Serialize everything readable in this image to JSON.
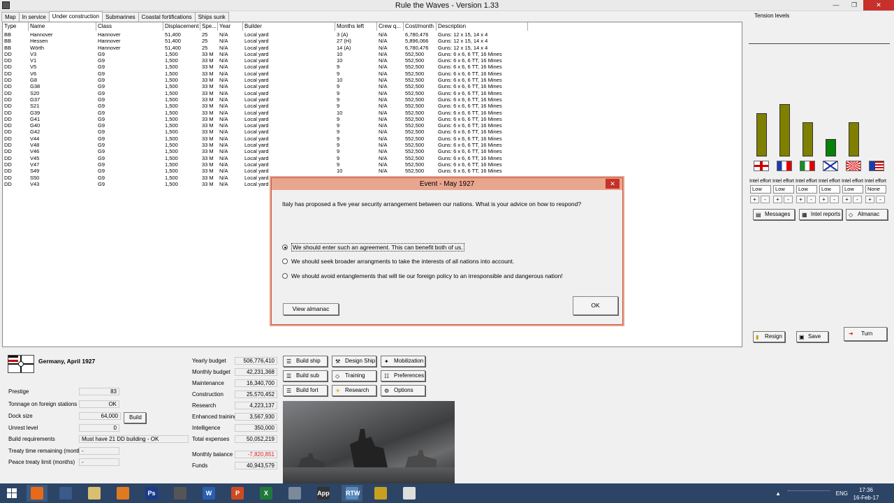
{
  "window": {
    "title": "Rule the Waves - Version 1.33",
    "minimize": "—",
    "restore": "❐",
    "close": "✕"
  },
  "tabs": [
    "Map",
    "In service",
    "Under construction",
    "Submarines",
    "Coastal fortifications",
    "Ships sunk"
  ],
  "active_tab": "Under construction",
  "table": {
    "columns": [
      "Type",
      "Name",
      "Class",
      "Displacement",
      "Spe...",
      "Year",
      "Builder",
      "Months left",
      "Crew q...",
      "Cost/month",
      "Description"
    ],
    "rows": [
      [
        "BB",
        "Hannover",
        "Hannover",
        "51,400",
        "25",
        "N/A",
        "Local yard",
        "3 (A)",
        "N/A",
        "6,780,476",
        "Guns: 12 x 15, 14 x 4"
      ],
      [
        "BB",
        "Hessen",
        "Hannover",
        "51,400",
        "25",
        "N/A",
        "Local yard",
        "27 (H)",
        "N/A",
        "5,896,066",
        "Guns: 12 x 15, 14 x 4"
      ],
      [
        "BB",
        "Wörth",
        "Hannover",
        "51,400",
        "25",
        "N/A",
        "Local yard",
        "14 (A)",
        "N/A",
        "6,780,476",
        "Guns: 12 x 15, 14 x 4"
      ],
      [
        "DD",
        "V3",
        "G9",
        "1,500",
        "33 M",
        "N/A",
        "Local yard",
        "10",
        "N/A",
        "552,500",
        "Guns: 6 x 6, 6 TT, 16 Mines"
      ],
      [
        "DD",
        "V1",
        "G9",
        "1,500",
        "33 M",
        "N/A",
        "Local yard",
        "10",
        "N/A",
        "552,500",
        "Guns: 6 x 6, 6 TT, 16 Mines"
      ],
      [
        "DD",
        "V5",
        "G9",
        "1,500",
        "33 M",
        "N/A",
        "Local yard",
        "9",
        "N/A",
        "552,500",
        "Guns: 6 x 6, 6 TT, 16 Mines"
      ],
      [
        "DD",
        "V6",
        "G9",
        "1,500",
        "33 M",
        "N/A",
        "Local yard",
        "9",
        "N/A",
        "552,500",
        "Guns: 6 x 6, 6 TT, 16 Mines"
      ],
      [
        "DD",
        "G8",
        "G9",
        "1,500",
        "33 M",
        "N/A",
        "Local yard",
        "10",
        "N/A",
        "552,500",
        "Guns: 6 x 6, 6 TT, 16 Mines"
      ],
      [
        "DD",
        "G38",
        "G9",
        "1,500",
        "33 M",
        "N/A",
        "Local yard",
        "9",
        "N/A",
        "552,500",
        "Guns: 6 x 6, 6 TT, 16 Mines"
      ],
      [
        "DD",
        "S20",
        "G9",
        "1,500",
        "33 M",
        "N/A",
        "Local yard",
        "9",
        "N/A",
        "552,500",
        "Guns: 6 x 6, 6 TT, 16 Mines"
      ],
      [
        "DD",
        "G37",
        "G9",
        "1,500",
        "33 M",
        "N/A",
        "Local yard",
        "9",
        "N/A",
        "552,500",
        "Guns: 6 x 6, 6 TT, 16 Mines"
      ],
      [
        "DD",
        "S21",
        "G9",
        "1,500",
        "33 M",
        "N/A",
        "Local yard",
        "9",
        "N/A",
        "552,500",
        "Guns: 6 x 6, 6 TT, 16 Mines"
      ],
      [
        "DD",
        "G39",
        "G9",
        "1,500",
        "33 M",
        "N/A",
        "Local yard",
        "10",
        "N/A",
        "552,500",
        "Guns: 6 x 6, 6 TT, 16 Mines"
      ],
      [
        "DD",
        "G41",
        "G9",
        "1,500",
        "33 M",
        "N/A",
        "Local yard",
        "9",
        "N/A",
        "552,500",
        "Guns: 6 x 6, 6 TT, 16 Mines"
      ],
      [
        "DD",
        "G40",
        "G9",
        "1,500",
        "33 M",
        "N/A",
        "Local yard",
        "9",
        "N/A",
        "552,500",
        "Guns: 6 x 6, 6 TT, 16 Mines"
      ],
      [
        "DD",
        "G42",
        "G9",
        "1,500",
        "33 M",
        "N/A",
        "Local yard",
        "9",
        "N/A",
        "552,500",
        "Guns: 6 x 6, 6 TT, 16 Mines"
      ],
      [
        "DD",
        "V44",
        "G9",
        "1,500",
        "33 M",
        "N/A",
        "Local yard",
        "9",
        "N/A",
        "552,500",
        "Guns: 6 x 6, 6 TT, 16 Mines"
      ],
      [
        "DD",
        "V48",
        "G9",
        "1,500",
        "33 M",
        "N/A",
        "Local yard",
        "9",
        "N/A",
        "552,500",
        "Guns: 6 x 6, 6 TT, 16 Mines"
      ],
      [
        "DD",
        "V46",
        "G9",
        "1,500",
        "33 M",
        "N/A",
        "Local yard",
        "9",
        "N/A",
        "552,500",
        "Guns: 6 x 6, 6 TT, 16 Mines"
      ],
      [
        "DD",
        "V45",
        "G9",
        "1,500",
        "33 M",
        "N/A",
        "Local yard",
        "9",
        "N/A",
        "552,500",
        "Guns: 6 x 6, 6 TT, 16 Mines"
      ],
      [
        "DD",
        "V47",
        "G9",
        "1,500",
        "33 M",
        "N/A",
        "Local yard",
        "9",
        "N/A",
        "552,500",
        "Guns: 6 x 6, 6 TT, 16 Mines"
      ],
      [
        "DD",
        "S49",
        "G9",
        "1,500",
        "33 M",
        "N/A",
        "Local yard",
        "10",
        "N/A",
        "552,500",
        "Guns: 6 x 6, 6 TT, 16 Mines"
      ],
      [
        "DD",
        "S50",
        "G9",
        "1,500",
        "33 M",
        "N/A",
        "Local yard",
        "",
        "",
        "",
        ""
      ],
      [
        "DD",
        "V43",
        "G9",
        "1,500",
        "33 M",
        "N/A",
        "Local yard",
        "",
        "",
        "",
        ""
      ]
    ]
  },
  "tension": {
    "label": "Tension levels",
    "nations": [
      {
        "flag": "uk-flag-icon",
        "level": 0.48,
        "color": "#7f7f00",
        "effort": "Low"
      },
      {
        "flag": "france-flag-icon",
        "level": 0.58,
        "color": "#7f7f00",
        "effort": "Low"
      },
      {
        "flag": "italy-flag-icon",
        "level": 0.38,
        "color": "#7f7f00",
        "effort": "Low"
      },
      {
        "flag": "russia-flag-icon",
        "level": 0.19,
        "color": "#0a7f0a",
        "effort": "Low"
      },
      {
        "flag": "japan-flag-icon",
        "level": 0.38,
        "color": "#7f7f00",
        "effort": "Low"
      },
      {
        "flag": "usa-flag-icon",
        "level": 0,
        "color": "#7f7f00",
        "effort": "None"
      }
    ],
    "intel_label": "Intel effort",
    "plus": "+",
    "minus": "-"
  },
  "side_buttons": {
    "messages": "Messages",
    "intel": "Intel reports",
    "almanac": "Almanac",
    "resign": "Resign",
    "save": "Save",
    "turn": "Turn"
  },
  "nation": {
    "title": "Germany, April 1927"
  },
  "stats_left": [
    {
      "label": "Prestige",
      "value": "83"
    },
    {
      "label": "Tonnage on foreign stations",
      "value": "OK"
    },
    {
      "label": "Dock size",
      "value": "64,000"
    },
    {
      "label": "Unrest level",
      "value": "0"
    },
    {
      "label": "Build requirements",
      "value": "Must have 21 DD building - OK"
    },
    {
      "label": "Treaty time remaining (months)",
      "value": "-"
    },
    {
      "label": "Peace treaty limit (months)",
      "value": "-"
    }
  ],
  "dock_build_label": "Build",
  "stats_mid": [
    {
      "label": "Yearly budget",
      "value": "506,776,410"
    },
    {
      "label": "Monthly budget",
      "value": "42,231,368"
    },
    {
      "label": "Maintenance",
      "value": "16,340,700"
    },
    {
      "label": "Construction",
      "value": "25,570,452"
    },
    {
      "label": "Research",
      "value": "4,223,137"
    },
    {
      "label": "Enhanced training",
      "value": "3,567,930"
    },
    {
      "label": "Intelligence",
      "value": "350,000"
    },
    {
      "label": "Total expenses",
      "value": "50,052,219"
    },
    {
      "label": "Monthly balance",
      "value": "-7,820,851"
    },
    {
      "label": "Funds",
      "value": "40,943,579"
    }
  ],
  "action_buttons": [
    "Build ship",
    "Design Ship",
    "Mobilization",
    "Build sub",
    "Training",
    "Preferences",
    "Build fort",
    "Research",
    "Options"
  ],
  "dialog": {
    "title": "Event - May 1927",
    "question": "Italy has proposed a five year security arrangement between our nations. What is your advice on how to respond?",
    "options": [
      "We should enter such an agreement. This can benefit both of us.",
      "We should seek broader arrangments to take the interests of all nations into account.",
      "We should avoid entanglements that will tie our foreign policy to an irresponsible and dangerous nation!"
    ],
    "selected": 0,
    "view_almanac": "View almanac",
    "ok": "OK"
  },
  "taskbar": {
    "apps": [
      "Firefox",
      "Steam",
      "Files",
      "Blender",
      "Ps",
      "Inkscape",
      "W",
      "P",
      "X",
      "Anchor",
      "App",
      "RTW",
      "Headset",
      "Paper"
    ],
    "lang": "ENG",
    "time": "17:36",
    "date": "16-Feb-17",
    "tray_arrow": "▲"
  },
  "colors": {
    "balance_negative": "#e02020",
    "accent_bar": "#7f7f00"
  }
}
